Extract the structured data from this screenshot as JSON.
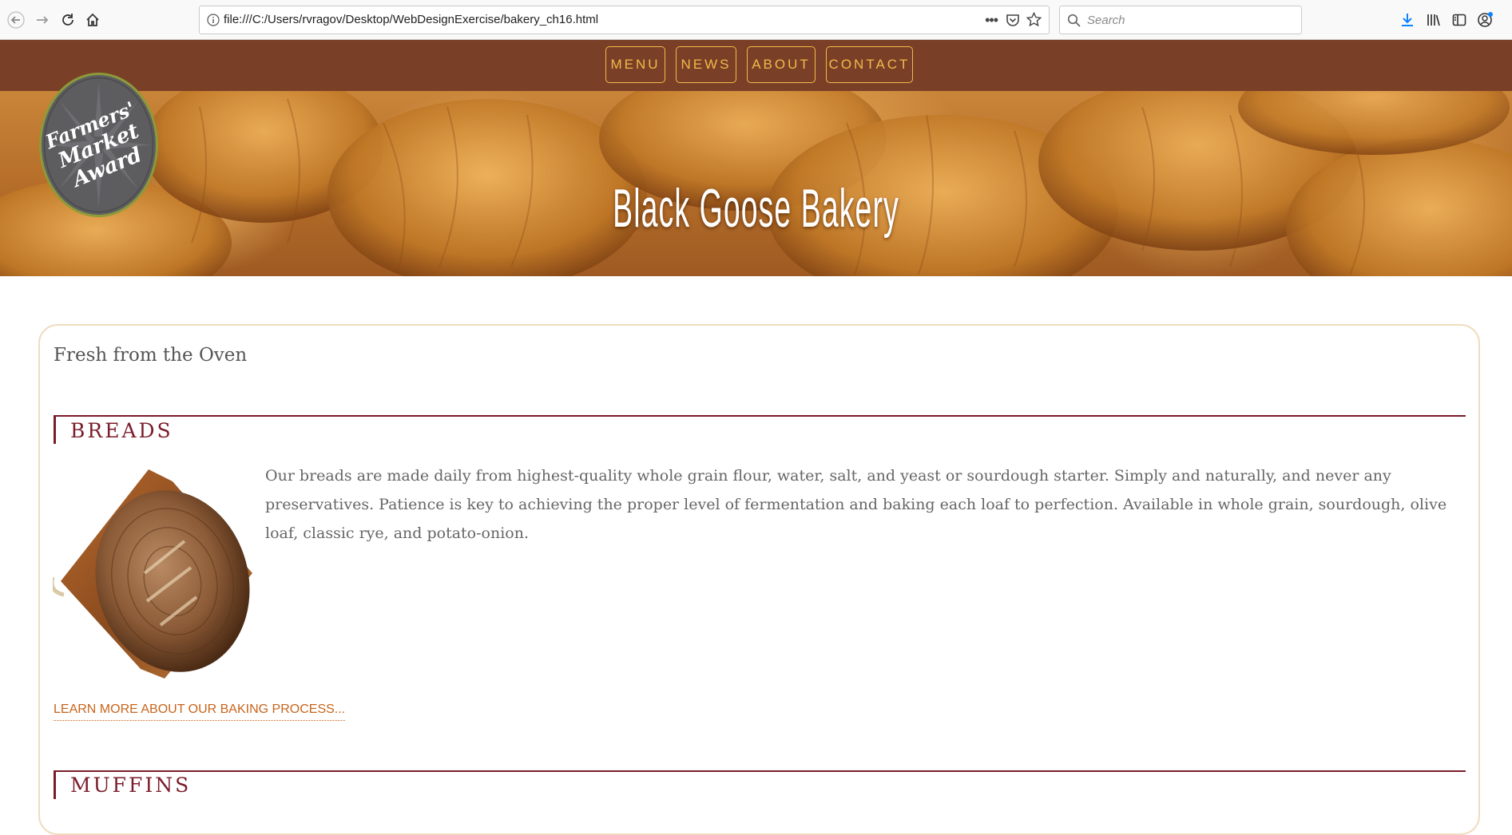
{
  "browser": {
    "url": "file:///C:/Users/rvragov/Desktop/WebDesignExercise/bakery_ch16.html",
    "search_placeholder": "Search"
  },
  "nav": {
    "items": [
      {
        "label": "MENU"
      },
      {
        "label": "NEWS"
      },
      {
        "label": "ABOUT"
      },
      {
        "label": "CONTACT"
      }
    ],
    "bg_color": "#7a4027",
    "accent_color": "#f2b84a"
  },
  "hero": {
    "title": "Black Goose Bakery",
    "badge_text": "Farmers' Market Award"
  },
  "content": {
    "heading": "Fresh from the Oven",
    "sections": [
      {
        "title": "BREADS",
        "image_alt": "round loaf of bread on wooden cutting board",
        "body": "Our breads are made daily from highest-quality whole grain flour, water, salt, and yeast or sourdough starter. Simply and naturally, and never any preservatives. Patience is key to achieving the proper level of fermentation and baking each loaf to perfection. Available in whole grain, sourdough, olive loaf, classic rye, and potato-onion.",
        "link": "LEARN MORE ABOUT OUR BAKING PROCESS..."
      },
      {
        "title": "MUFFINS"
      }
    ],
    "section_color": "#7a1d2a",
    "link_color": "#c8651b"
  }
}
